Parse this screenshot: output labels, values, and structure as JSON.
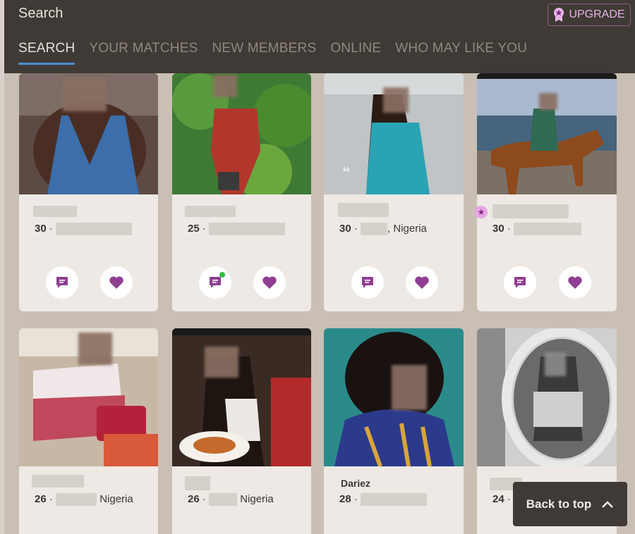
{
  "header": {
    "title": "Search",
    "upgrade_label": "UPGRADE",
    "tabs": [
      {
        "label": "SEARCH",
        "active": true
      },
      {
        "label": "YOUR MATCHES",
        "active": false
      },
      {
        "label": "NEW MEMBERS",
        "active": false
      },
      {
        "label": "ONLINE",
        "active": false
      },
      {
        "label": "WHO MAY LIKE YOU",
        "active": false
      }
    ]
  },
  "profiles": [
    {
      "name": "",
      "age": "30",
      "location": "",
      "premium": false,
      "online": false
    },
    {
      "name": "",
      "age": "25",
      "location": "",
      "premium": false,
      "online": true
    },
    {
      "name": "",
      "age": "30",
      "location": ", Nigeria",
      "premium": false,
      "online": false
    },
    {
      "name": "",
      "age": "30",
      "location": "",
      "premium": true,
      "online": false
    },
    {
      "name": "",
      "age": "26",
      "location": "Nigeria",
      "premium": false,
      "online": false
    },
    {
      "name": "",
      "age": "26",
      "location": "Nigeria",
      "premium": false,
      "online": false
    },
    {
      "name": "Dariez",
      "age": "28",
      "location": "",
      "premium": false,
      "online": false
    },
    {
      "name": "",
      "age": "24",
      "location": "",
      "premium": false,
      "online": false
    }
  ],
  "separator": "·",
  "back_to_top_label": "Back to top",
  "colors": {
    "accent_purple": "#8e3f91",
    "header_bg": "#3f3a35",
    "tab_underline": "#4a8fd6",
    "online_dot": "#2fbe3c"
  },
  "icons": {
    "message": "chat-bubble-icon",
    "like": "heart-icon",
    "upgrade": "ribbon-star-icon",
    "back": "chevron-up-icon",
    "premium": "star-icon"
  }
}
